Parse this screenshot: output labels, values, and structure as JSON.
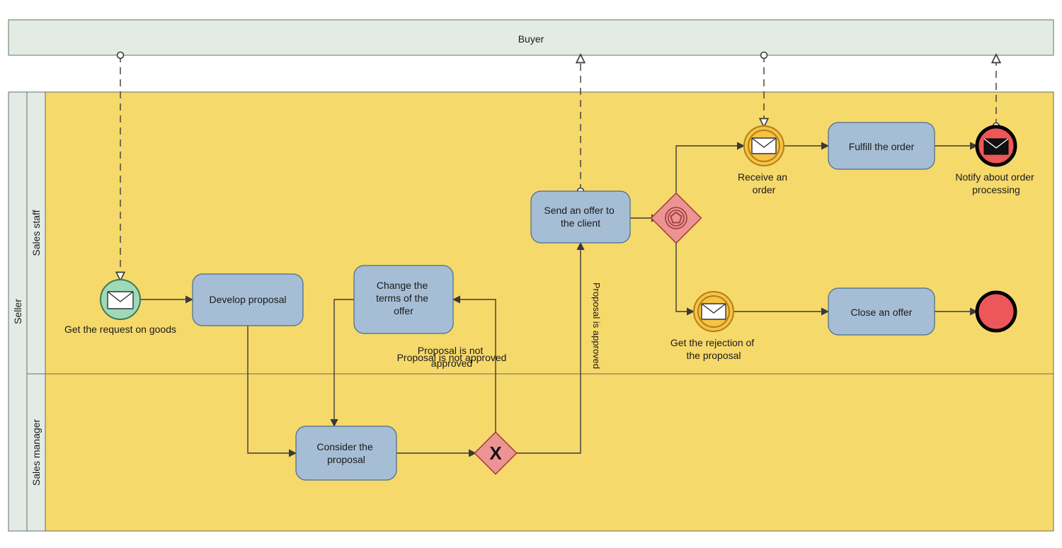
{
  "pools": {
    "buyer": {
      "label": "Buyer"
    },
    "seller": {
      "label": "Seller"
    }
  },
  "lanes": {
    "sales_staff": {
      "label": "Sales staff"
    },
    "sales_manager": {
      "label": "Sales manager"
    }
  },
  "events": {
    "start_request": {
      "label": "Get the request on goods"
    },
    "receive_order": {
      "label": "Receive an order"
    },
    "get_rejection": {
      "label": "Get the rejection of the proposal"
    },
    "end_notify": {
      "label": "Notify about order processing"
    }
  },
  "tasks": {
    "develop_proposal": {
      "label": "Develop proposal"
    },
    "change_terms": {
      "label": "Change the terms of the offer"
    },
    "send_offer": {
      "label": "Send an offer to the client"
    },
    "fulfill_order": {
      "label": "Fulfill the order"
    },
    "close_offer": {
      "label": "Close an offer"
    },
    "consider_proposal": {
      "label": "Consider the proposal"
    }
  },
  "gateways": {
    "exclusive": {
      "marker": "X"
    }
  },
  "flow_labels": {
    "not_approved": "Proposal is not approved",
    "approved": "Proposal is approved"
  },
  "colors": {
    "lane_fill": "#f6d96b",
    "task_fill": "#a6bed5",
    "gateway_fill": "#ed9393",
    "start_fill": "#9fd9b7",
    "intermediate_fill": "#f6c344",
    "end_fill": "#ed5757"
  }
}
